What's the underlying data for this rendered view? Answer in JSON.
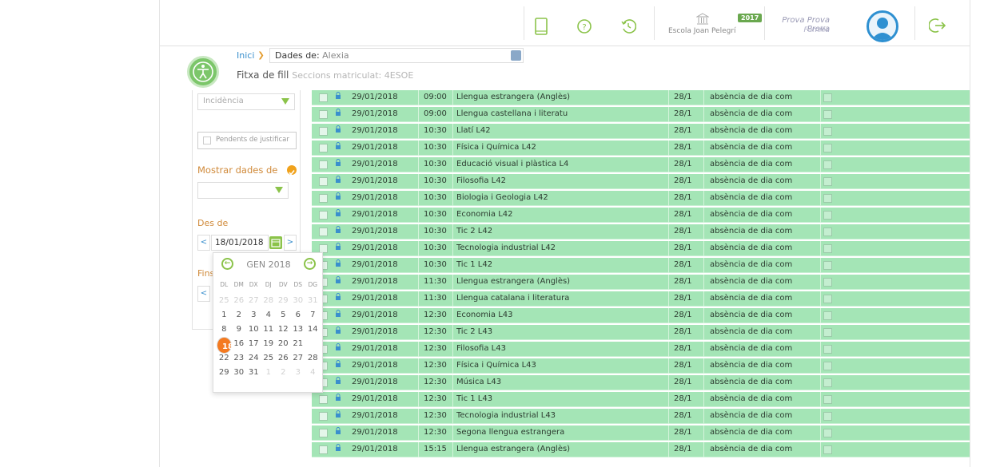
{
  "topbar": {
    "school_name": "Escola Joan Pelegrí",
    "year_badge": "2017",
    "user_name": "Prova Prova Prova",
    "user_role": "Família"
  },
  "header": {
    "home_link": "Inici",
    "data_label": "Dades de:",
    "student_name": "Alexia",
    "page_title": "Fitxa de fill",
    "page_subtitle": "Seccions matriculat: 4ESOE"
  },
  "filters": {
    "type_value": "Incidència",
    "pending_label": "Pendents de justificar",
    "show_data_label": "Mostrar dades de",
    "from_label": "Des de",
    "from_date": "18/01/2018",
    "to_label": "Fins"
  },
  "calendar": {
    "month_label": "GEN 2018",
    "weekdays": [
      "DL",
      "DM",
      "DX",
      "DJ",
      "DV",
      "DS",
      "DG"
    ],
    "weeks": [
      [
        "25",
        "26",
        "27",
        "28",
        "29",
        "30",
        "31"
      ],
      [
        "1",
        "2",
        "3",
        "4",
        "5",
        "6",
        "7"
      ],
      [
        "8",
        "9",
        "10",
        "11",
        "12",
        "13",
        "14"
      ],
      [
        "15",
        "16",
        "17",
        "18",
        "19",
        "20",
        "21"
      ],
      [
        "22",
        "23",
        "24",
        "25",
        "26",
        "27",
        "28"
      ],
      [
        "29",
        "30",
        "31",
        "1",
        "2",
        "3",
        "4"
      ]
    ],
    "selected_day": "18"
  },
  "table": {
    "rows": [
      {
        "date": "29/01/2018",
        "time": "09:00",
        "subject": "Llengua estrangera (Anglès)",
        "day": "28/1",
        "type": "absència de dia com"
      },
      {
        "date": "29/01/2018",
        "time": "09:00",
        "subject": "Llengua castellana i literatu",
        "day": "28/1",
        "type": "absència de dia com"
      },
      {
        "date": "29/01/2018",
        "time": "10:30",
        "subject": "Llatí L42",
        "day": "28/1",
        "type": "absència de dia com"
      },
      {
        "date": "29/01/2018",
        "time": "10:30",
        "subject": "Física i Química L42",
        "day": "28/1",
        "type": "absència de dia com"
      },
      {
        "date": "29/01/2018",
        "time": "10:30",
        "subject": "Educació visual i plàstica L4",
        "day": "28/1",
        "type": "absència de dia com"
      },
      {
        "date": "29/01/2018",
        "time": "10:30",
        "subject": "Filosofia L42",
        "day": "28/1",
        "type": "absència de dia com"
      },
      {
        "date": "29/01/2018",
        "time": "10:30",
        "subject": "Biologia i Geologia L42",
        "day": "28/1",
        "type": "absència de dia com"
      },
      {
        "date": "29/01/2018",
        "time": "10:30",
        "subject": "Economia L42",
        "day": "28/1",
        "type": "absència de dia com"
      },
      {
        "date": "29/01/2018",
        "time": "10:30",
        "subject": "Tic 2 L42",
        "day": "28/1",
        "type": "absència de dia com"
      },
      {
        "date": "29/01/2018",
        "time": "10:30",
        "subject": "Tecnologia industrial L42",
        "day": "28/1",
        "type": "absència de dia com"
      },
      {
        "date": "29/01/2018",
        "time": "10:30",
        "subject": "Tic 1 L42",
        "day": "28/1",
        "type": "absència de dia com"
      },
      {
        "date": "29/01/2018",
        "time": "11:30",
        "subject": "Llengua estrangera (Anglès)",
        "day": "28/1",
        "type": "absència de dia com"
      },
      {
        "date": "29/01/2018",
        "time": "11:30",
        "subject": "Llengua catalana i literatura",
        "day": "28/1",
        "type": "absència de dia com"
      },
      {
        "date": "29/01/2018",
        "time": "12:30",
        "subject": "Economia L43",
        "day": "28/1",
        "type": "absència de dia com"
      },
      {
        "date": "29/01/2018",
        "time": "12:30",
        "subject": "Tic 2 L43",
        "day": "28/1",
        "type": "absència de dia com"
      },
      {
        "date": "29/01/2018",
        "time": "12:30",
        "subject": "Filosofia L43",
        "day": "28/1",
        "type": "absència de dia com"
      },
      {
        "date": "29/01/2018",
        "time": "12:30",
        "subject": "Física i Química L43",
        "day": "28/1",
        "type": "absència de dia com"
      },
      {
        "date": "29/01/2018",
        "time": "12:30",
        "subject": "Música L43",
        "day": "28/1",
        "type": "absència de dia com"
      },
      {
        "date": "29/01/2018",
        "time": "12:30",
        "subject": "Tic 1 L43",
        "day": "28/1",
        "type": "absència de dia com"
      },
      {
        "date": "29/01/2018",
        "time": "12:30",
        "subject": "Tecnologia industrial L43",
        "day": "28/1",
        "type": "absència de dia com"
      },
      {
        "date": "29/01/2018",
        "time": "12:30",
        "subject": "Segona llengua estrangera",
        "day": "28/1",
        "type": "absència de dia com"
      },
      {
        "date": "29/01/2018",
        "time": "15:15",
        "subject": "Llengua estrangera (Anglès)",
        "day": "28/1",
        "type": "absència de dia com"
      }
    ]
  },
  "colors": {
    "row_green": "#a4e5b6",
    "accent_orange": "#f47a20",
    "accent_green": "#8bc34a",
    "link_blue": "#3a8fcd"
  }
}
